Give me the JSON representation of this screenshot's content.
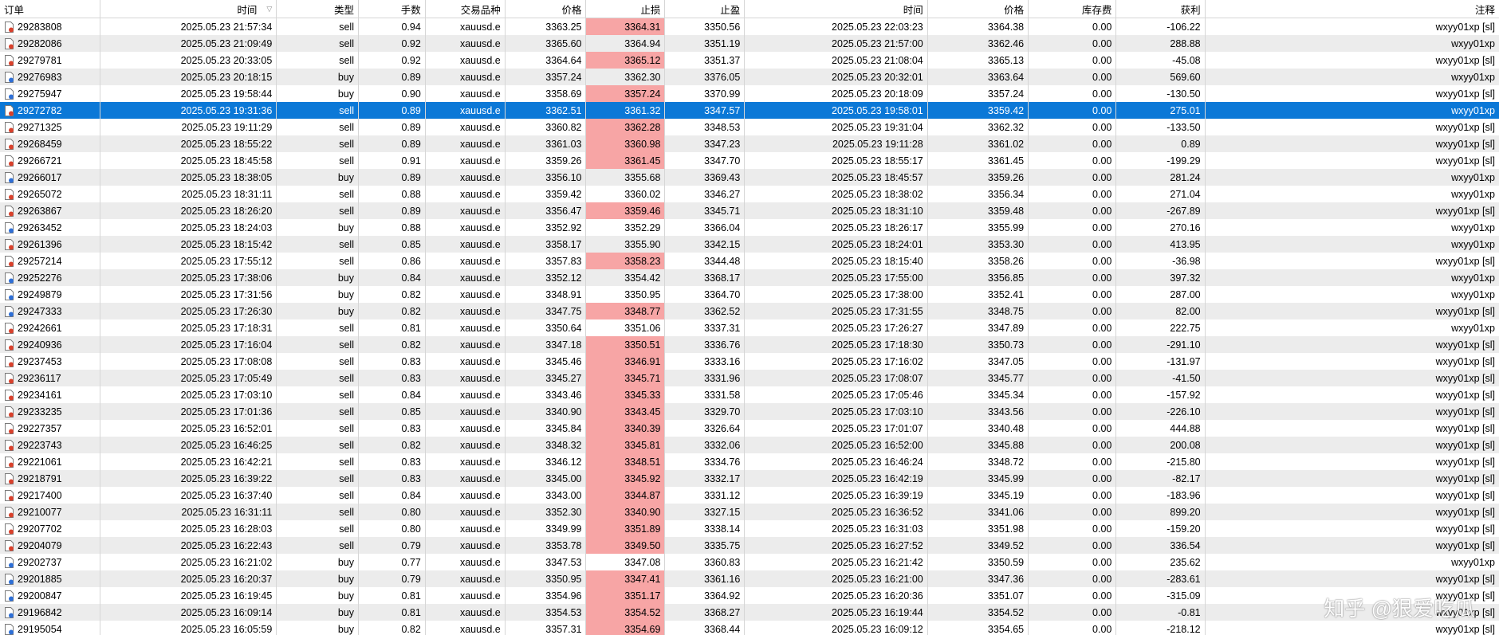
{
  "table": {
    "headers": {
      "order": "订单",
      "open_time": "时间",
      "type": "类型",
      "lots": "手数",
      "symbol": "交易品种",
      "open_price": "价格",
      "sl": "止损",
      "tp": "止盈",
      "close_time": "时间",
      "close_price": "价格",
      "swap": "库存费",
      "profit": "获利",
      "comment": "注释"
    },
    "sort_indicator": "▽",
    "row_icon_colors": {
      "sell": "#d9412c",
      "buy": "#2e6fd6"
    },
    "sl_highlight_color": "#f7a5a5",
    "selection_color": "#0b78d7",
    "rows": [
      {
        "order": "29283808",
        "open_time": "2025.05.23 21:57:34",
        "type": "sell",
        "lots": "0.94",
        "symbol": "xauusd.e",
        "open_price": "3363.25",
        "sl": "3364.31",
        "sl_hit": true,
        "tp": "3350.56",
        "close_time": "2025.05.23 22:03:23",
        "close_price": "3364.38",
        "swap": "0.00",
        "profit": "-106.22",
        "comment": "wxyy01xp [sl]"
      },
      {
        "order": "29282086",
        "open_time": "2025.05.23 21:09:49",
        "type": "sell",
        "lots": "0.92",
        "symbol": "xauusd.e",
        "open_price": "3365.60",
        "sl": "3364.94",
        "sl_hit": false,
        "tp": "3351.19",
        "close_time": "2025.05.23 21:57:00",
        "close_price": "3362.46",
        "swap": "0.00",
        "profit": "288.88",
        "comment": "wxyy01xp"
      },
      {
        "order": "29279781",
        "open_time": "2025.05.23 20:33:05",
        "type": "sell",
        "lots": "0.92",
        "symbol": "xauusd.e",
        "open_price": "3364.64",
        "sl": "3365.12",
        "sl_hit": true,
        "tp": "3351.37",
        "close_time": "2025.05.23 21:08:04",
        "close_price": "3365.13",
        "swap": "0.00",
        "profit": "-45.08",
        "comment": "wxyy01xp [sl]"
      },
      {
        "order": "29276983",
        "open_time": "2025.05.23 20:18:15",
        "type": "buy",
        "lots": "0.89",
        "symbol": "xauusd.e",
        "open_price": "3357.24",
        "sl": "3362.30",
        "sl_hit": false,
        "tp": "3376.05",
        "close_time": "2025.05.23 20:32:01",
        "close_price": "3363.64",
        "swap": "0.00",
        "profit": "569.60",
        "comment": "wxyy01xp"
      },
      {
        "order": "29275947",
        "open_time": "2025.05.23 19:58:44",
        "type": "buy",
        "lots": "0.90",
        "symbol": "xauusd.e",
        "open_price": "3358.69",
        "sl": "3357.24",
        "sl_hit": true,
        "tp": "3370.99",
        "close_time": "2025.05.23 20:18:09",
        "close_price": "3357.24",
        "swap": "0.00",
        "profit": "-130.50",
        "comment": "wxyy01xp [sl]"
      },
      {
        "order": "29272782",
        "open_time": "2025.05.23 19:31:36",
        "type": "sell",
        "lots": "0.89",
        "symbol": "xauusd.e",
        "open_price": "3362.51",
        "sl": "3361.32",
        "sl_hit": false,
        "tp": "3347.57",
        "close_time": "2025.05.23 19:58:01",
        "close_price": "3359.42",
        "swap": "0.00",
        "profit": "275.01",
        "comment": "wxyy01xp",
        "selected": true
      },
      {
        "order": "29271325",
        "open_time": "2025.05.23 19:11:29",
        "type": "sell",
        "lots": "0.89",
        "symbol": "xauusd.e",
        "open_price": "3360.82",
        "sl": "3362.28",
        "sl_hit": true,
        "tp": "3348.53",
        "close_time": "2025.05.23 19:31:04",
        "close_price": "3362.32",
        "swap": "0.00",
        "profit": "-133.50",
        "comment": "wxyy01xp [sl]"
      },
      {
        "order": "29268459",
        "open_time": "2025.05.23 18:55:22",
        "type": "sell",
        "lots": "0.89",
        "symbol": "xauusd.e",
        "open_price": "3361.03",
        "sl": "3360.98",
        "sl_hit": true,
        "tp": "3347.23",
        "close_time": "2025.05.23 19:11:28",
        "close_price": "3361.02",
        "swap": "0.00",
        "profit": "0.89",
        "comment": "wxyy01xp [sl]"
      },
      {
        "order": "29266721",
        "open_time": "2025.05.23 18:45:58",
        "type": "sell",
        "lots": "0.91",
        "symbol": "xauusd.e",
        "open_price": "3359.26",
        "sl": "3361.45",
        "sl_hit": true,
        "tp": "3347.70",
        "close_time": "2025.05.23 18:55:17",
        "close_price": "3361.45",
        "swap": "0.00",
        "profit": "-199.29",
        "comment": "wxyy01xp [sl]"
      },
      {
        "order": "29266017",
        "open_time": "2025.05.23 18:38:05",
        "type": "buy",
        "lots": "0.89",
        "symbol": "xauusd.e",
        "open_price": "3356.10",
        "sl": "3355.68",
        "sl_hit": false,
        "tp": "3369.43",
        "close_time": "2025.05.23 18:45:57",
        "close_price": "3359.26",
        "swap": "0.00",
        "profit": "281.24",
        "comment": "wxyy01xp"
      },
      {
        "order": "29265072",
        "open_time": "2025.05.23 18:31:11",
        "type": "sell",
        "lots": "0.88",
        "symbol": "xauusd.e",
        "open_price": "3359.42",
        "sl": "3360.02",
        "sl_hit": false,
        "tp": "3346.27",
        "close_time": "2025.05.23 18:38:02",
        "close_price": "3356.34",
        "swap": "0.00",
        "profit": "271.04",
        "comment": "wxyy01xp"
      },
      {
        "order": "29263867",
        "open_time": "2025.05.23 18:26:20",
        "type": "sell",
        "lots": "0.89",
        "symbol": "xauusd.e",
        "open_price": "3356.47",
        "sl": "3359.46",
        "sl_hit": true,
        "tp": "3345.71",
        "close_time": "2025.05.23 18:31:10",
        "close_price": "3359.48",
        "swap": "0.00",
        "profit": "-267.89",
        "comment": "wxyy01xp [sl]"
      },
      {
        "order": "29263452",
        "open_time": "2025.05.23 18:24:03",
        "type": "buy",
        "lots": "0.88",
        "symbol": "xauusd.e",
        "open_price": "3352.92",
        "sl": "3352.29",
        "sl_hit": false,
        "tp": "3366.04",
        "close_time": "2025.05.23 18:26:17",
        "close_price": "3355.99",
        "swap": "0.00",
        "profit": "270.16",
        "comment": "wxyy01xp"
      },
      {
        "order": "29261396",
        "open_time": "2025.05.23 18:15:42",
        "type": "sell",
        "lots": "0.85",
        "symbol": "xauusd.e",
        "open_price": "3358.17",
        "sl": "3355.90",
        "sl_hit": false,
        "tp": "3342.15",
        "close_time": "2025.05.23 18:24:01",
        "close_price": "3353.30",
        "swap": "0.00",
        "profit": "413.95",
        "comment": "wxyy01xp"
      },
      {
        "order": "29257214",
        "open_time": "2025.05.23 17:55:12",
        "type": "sell",
        "lots": "0.86",
        "symbol": "xauusd.e",
        "open_price": "3357.83",
        "sl": "3358.23",
        "sl_hit": true,
        "tp": "3344.48",
        "close_time": "2025.05.23 18:15:40",
        "close_price": "3358.26",
        "swap": "0.00",
        "profit": "-36.98",
        "comment": "wxyy01xp [sl]"
      },
      {
        "order": "29252276",
        "open_time": "2025.05.23 17:38:06",
        "type": "buy",
        "lots": "0.84",
        "symbol": "xauusd.e",
        "open_price": "3352.12",
        "sl": "3354.42",
        "sl_hit": false,
        "tp": "3368.17",
        "close_time": "2025.05.23 17:55:00",
        "close_price": "3356.85",
        "swap": "0.00",
        "profit": "397.32",
        "comment": "wxyy01xp"
      },
      {
        "order": "29249879",
        "open_time": "2025.05.23 17:31:56",
        "type": "buy",
        "lots": "0.82",
        "symbol": "xauusd.e",
        "open_price": "3348.91",
        "sl": "3350.95",
        "sl_hit": false,
        "tp": "3364.70",
        "close_time": "2025.05.23 17:38:00",
        "close_price": "3352.41",
        "swap": "0.00",
        "profit": "287.00",
        "comment": "wxyy01xp"
      },
      {
        "order": "29247333",
        "open_time": "2025.05.23 17:26:30",
        "type": "buy",
        "lots": "0.82",
        "symbol": "xauusd.e",
        "open_price": "3347.75",
        "sl": "3348.77",
        "sl_hit": true,
        "tp": "3362.52",
        "close_time": "2025.05.23 17:31:55",
        "close_price": "3348.75",
        "swap": "0.00",
        "profit": "82.00",
        "comment": "wxyy01xp [sl]"
      },
      {
        "order": "29242661",
        "open_time": "2025.05.23 17:18:31",
        "type": "sell",
        "lots": "0.81",
        "symbol": "xauusd.e",
        "open_price": "3350.64",
        "sl": "3351.06",
        "sl_hit": false,
        "tp": "3337.31",
        "close_time": "2025.05.23 17:26:27",
        "close_price": "3347.89",
        "swap": "0.00",
        "profit": "222.75",
        "comment": "wxyy01xp"
      },
      {
        "order": "29240936",
        "open_time": "2025.05.23 17:16:04",
        "type": "sell",
        "lots": "0.82",
        "symbol": "xauusd.e",
        "open_price": "3347.18",
        "sl": "3350.51",
        "sl_hit": true,
        "tp": "3336.76",
        "close_time": "2025.05.23 17:18:30",
        "close_price": "3350.73",
        "swap": "0.00",
        "profit": "-291.10",
        "comment": "wxyy01xp [sl]"
      },
      {
        "order": "29237453",
        "open_time": "2025.05.23 17:08:08",
        "type": "sell",
        "lots": "0.83",
        "symbol": "xauusd.e",
        "open_price": "3345.46",
        "sl": "3346.91",
        "sl_hit": true,
        "tp": "3333.16",
        "close_time": "2025.05.23 17:16:02",
        "close_price": "3347.05",
        "swap": "0.00",
        "profit": "-131.97",
        "comment": "wxyy01xp [sl]"
      },
      {
        "order": "29236117",
        "open_time": "2025.05.23 17:05:49",
        "type": "sell",
        "lots": "0.83",
        "symbol": "xauusd.e",
        "open_price": "3345.27",
        "sl": "3345.71",
        "sl_hit": true,
        "tp": "3331.96",
        "close_time": "2025.05.23 17:08:07",
        "close_price": "3345.77",
        "swap": "0.00",
        "profit": "-41.50",
        "comment": "wxyy01xp [sl]"
      },
      {
        "order": "29234161",
        "open_time": "2025.05.23 17:03:10",
        "type": "sell",
        "lots": "0.84",
        "symbol": "xauusd.e",
        "open_price": "3343.46",
        "sl": "3345.33",
        "sl_hit": true,
        "tp": "3331.58",
        "close_time": "2025.05.23 17:05:46",
        "close_price": "3345.34",
        "swap": "0.00",
        "profit": "-157.92",
        "comment": "wxyy01xp [sl]"
      },
      {
        "order": "29233235",
        "open_time": "2025.05.23 17:01:36",
        "type": "sell",
        "lots": "0.85",
        "symbol": "xauusd.e",
        "open_price": "3340.90",
        "sl": "3343.45",
        "sl_hit": true,
        "tp": "3329.70",
        "close_time": "2025.05.23 17:03:10",
        "close_price": "3343.56",
        "swap": "0.00",
        "profit": "-226.10",
        "comment": "wxyy01xp [sl]"
      },
      {
        "order": "29227357",
        "open_time": "2025.05.23 16:52:01",
        "type": "sell",
        "lots": "0.83",
        "symbol": "xauusd.e",
        "open_price": "3345.84",
        "sl": "3340.39",
        "sl_hit": true,
        "tp": "3326.64",
        "close_time": "2025.05.23 17:01:07",
        "close_price": "3340.48",
        "swap": "0.00",
        "profit": "444.88",
        "comment": "wxyy01xp [sl]"
      },
      {
        "order": "29223743",
        "open_time": "2025.05.23 16:46:25",
        "type": "sell",
        "lots": "0.82",
        "symbol": "xauusd.e",
        "open_price": "3348.32",
        "sl": "3345.81",
        "sl_hit": true,
        "tp": "3332.06",
        "close_time": "2025.05.23 16:52:00",
        "close_price": "3345.88",
        "swap": "0.00",
        "profit": "200.08",
        "comment": "wxyy01xp [sl]"
      },
      {
        "order": "29221061",
        "open_time": "2025.05.23 16:42:21",
        "type": "sell",
        "lots": "0.83",
        "symbol": "xauusd.e",
        "open_price": "3346.12",
        "sl": "3348.51",
        "sl_hit": true,
        "tp": "3334.76",
        "close_time": "2025.05.23 16:46:24",
        "close_price": "3348.72",
        "swap": "0.00",
        "profit": "-215.80",
        "comment": "wxyy01xp [sl]"
      },
      {
        "order": "29218791",
        "open_time": "2025.05.23 16:39:22",
        "type": "sell",
        "lots": "0.83",
        "symbol": "xauusd.e",
        "open_price": "3345.00",
        "sl": "3345.92",
        "sl_hit": true,
        "tp": "3332.17",
        "close_time": "2025.05.23 16:42:19",
        "close_price": "3345.99",
        "swap": "0.00",
        "profit": "-82.17",
        "comment": "wxyy01xp [sl]"
      },
      {
        "order": "29217400",
        "open_time": "2025.05.23 16:37:40",
        "type": "sell",
        "lots": "0.84",
        "symbol": "xauusd.e",
        "open_price": "3343.00",
        "sl": "3344.87",
        "sl_hit": true,
        "tp": "3331.12",
        "close_time": "2025.05.23 16:39:19",
        "close_price": "3345.19",
        "swap": "0.00",
        "profit": "-183.96",
        "comment": "wxyy01xp [sl]"
      },
      {
        "order": "29210077",
        "open_time": "2025.05.23 16:31:11",
        "type": "sell",
        "lots": "0.80",
        "symbol": "xauusd.e",
        "open_price": "3352.30",
        "sl": "3340.90",
        "sl_hit": true,
        "tp": "3327.15",
        "close_time": "2025.05.23 16:36:52",
        "close_price": "3341.06",
        "swap": "0.00",
        "profit": "899.20",
        "comment": "wxyy01xp [sl]"
      },
      {
        "order": "29207702",
        "open_time": "2025.05.23 16:28:03",
        "type": "sell",
        "lots": "0.80",
        "symbol": "xauusd.e",
        "open_price": "3349.99",
        "sl": "3351.89",
        "sl_hit": true,
        "tp": "3338.14",
        "close_time": "2025.05.23 16:31:03",
        "close_price": "3351.98",
        "swap": "0.00",
        "profit": "-159.20",
        "comment": "wxyy01xp [sl]"
      },
      {
        "order": "29204079",
        "open_time": "2025.05.23 16:22:43",
        "type": "sell",
        "lots": "0.79",
        "symbol": "xauusd.e",
        "open_price": "3353.78",
        "sl": "3349.50",
        "sl_hit": true,
        "tp": "3335.75",
        "close_time": "2025.05.23 16:27:52",
        "close_price": "3349.52",
        "swap": "0.00",
        "profit": "336.54",
        "comment": "wxyy01xp [sl]"
      },
      {
        "order": "29202737",
        "open_time": "2025.05.23 16:21:02",
        "type": "buy",
        "lots": "0.77",
        "symbol": "xauusd.e",
        "open_price": "3347.53",
        "sl": "3347.08",
        "sl_hit": false,
        "tp": "3360.83",
        "close_time": "2025.05.23 16:21:42",
        "close_price": "3350.59",
        "swap": "0.00",
        "profit": "235.62",
        "comment": "wxyy01xp"
      },
      {
        "order": "29201885",
        "open_time": "2025.05.23 16:20:37",
        "type": "buy",
        "lots": "0.79",
        "symbol": "xauusd.e",
        "open_price": "3350.95",
        "sl": "3347.41",
        "sl_hit": true,
        "tp": "3361.16",
        "close_time": "2025.05.23 16:21:00",
        "close_price": "3347.36",
        "swap": "0.00",
        "profit": "-283.61",
        "comment": "wxyy01xp [sl]"
      },
      {
        "order": "29200847",
        "open_time": "2025.05.23 16:19:45",
        "type": "buy",
        "lots": "0.81",
        "symbol": "xauusd.e",
        "open_price": "3354.96",
        "sl": "3351.17",
        "sl_hit": true,
        "tp": "3364.92",
        "close_time": "2025.05.23 16:20:36",
        "close_price": "3351.07",
        "swap": "0.00",
        "profit": "-315.09",
        "comment": "wxyy01xp [sl]"
      },
      {
        "order": "29196842",
        "open_time": "2025.05.23 16:09:14",
        "type": "buy",
        "lots": "0.81",
        "symbol": "xauusd.e",
        "open_price": "3354.53",
        "sl": "3354.52",
        "sl_hit": true,
        "tp": "3368.27",
        "close_time": "2025.05.23 16:19:44",
        "close_price": "3354.52",
        "swap": "0.00",
        "profit": "-0.81",
        "comment": "wxyy01xp [sl]"
      },
      {
        "order": "29195054",
        "open_time": "2025.05.23 16:05:59",
        "type": "buy",
        "lots": "0.82",
        "symbol": "xauusd.e",
        "open_price": "3357.31",
        "sl": "3354.69",
        "sl_hit": true,
        "tp": "3368.44",
        "close_time": "2025.05.23 16:09:12",
        "close_price": "3354.65",
        "swap": "0.00",
        "profit": "-218.12",
        "comment": "wxyy01xp [sl]"
      }
    ]
  },
  "watermark": "知乎 @狠爱吃瓜"
}
